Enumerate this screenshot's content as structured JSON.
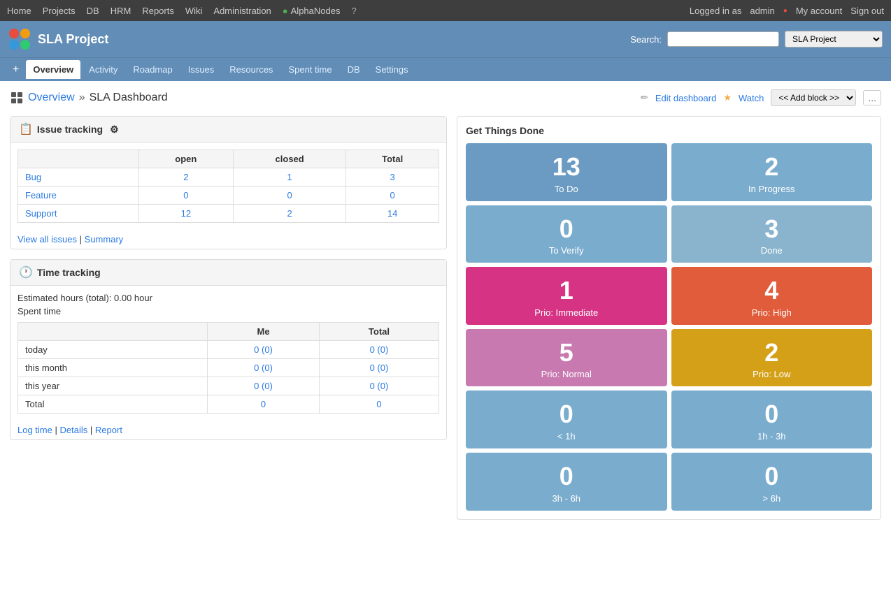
{
  "topnav": {
    "items": [
      "Home",
      "Projects",
      "DB",
      "HRM",
      "Reports",
      "Wiki",
      "Administration",
      "AlphaNodes"
    ],
    "logged_in_as": "Logged in as",
    "admin_label": "admin",
    "my_account": "My account",
    "sign_out": "Sign out"
  },
  "project": {
    "title": "SLA Project",
    "search_label": "Search:",
    "search_placeholder": "",
    "search_scope": "SLA Project"
  },
  "subnav": {
    "plus": "+",
    "items": [
      "Overview",
      "Activity",
      "Roadmap",
      "Issues",
      "Resources",
      "Spent time",
      "DB",
      "Settings"
    ]
  },
  "breadcrumb": {
    "overview": "Overview",
    "separator": "»",
    "page": "SLA Dashboard"
  },
  "page_actions": {
    "edit_dashboard": "Edit dashboard",
    "watch": "Watch",
    "add_block": "<< Add block >>",
    "more": "..."
  },
  "issue_tracking": {
    "title": "Issue tracking",
    "headers": [
      "",
      "open",
      "closed",
      "Total"
    ],
    "rows": [
      {
        "label": "Bug",
        "open": "2",
        "closed": "1",
        "total": "3"
      },
      {
        "label": "Feature",
        "open": "0",
        "closed": "0",
        "total": "0"
      },
      {
        "label": "Support",
        "open": "12",
        "closed": "2",
        "total": "14"
      }
    ],
    "view_all": "View all issues",
    "summary": "Summary"
  },
  "time_tracking": {
    "title": "Time tracking",
    "estimated_hours": "Estimated hours (total): 0.00 hour",
    "spent_time_label": "Spent time",
    "headers": [
      "",
      "Me",
      "Total"
    ],
    "rows": [
      {
        "label": "today",
        "me": "0 (0)",
        "total": "0 (0)"
      },
      {
        "label": "this month",
        "me": "0 (0)",
        "total": "0 (0)"
      },
      {
        "label": "this year",
        "me": "0 (0)",
        "total": "0 (0)"
      },
      {
        "label": "Total",
        "me": "0",
        "total": "0"
      }
    ],
    "log_time": "Log time",
    "details": "Details",
    "report": "Report"
  },
  "gtd": {
    "title": "Get Things Done",
    "cards": [
      {
        "number": "13",
        "label": "To Do",
        "class": "gtd-todo"
      },
      {
        "number": "2",
        "label": "In Progress",
        "class": "gtd-inprogress"
      },
      {
        "number": "0",
        "label": "To Verify",
        "class": "gtd-toverify"
      },
      {
        "number": "3",
        "label": "Done",
        "class": "gtd-done"
      },
      {
        "number": "1",
        "label": "Prio: Immediate",
        "class": "gtd-immediate"
      },
      {
        "number": "4",
        "label": "Prio: High",
        "class": "gtd-high"
      },
      {
        "number": "5",
        "label": "Prio: Normal",
        "class": "gtd-normal"
      },
      {
        "number": "2",
        "label": "Prio: Low",
        "class": "gtd-low"
      },
      {
        "number": "0",
        "label": "< 1h",
        "class": "gtd-less1h"
      },
      {
        "number": "0",
        "label": "1h - 3h",
        "class": "gtd-1h3h"
      },
      {
        "number": "0",
        "label": "3h - 6h",
        "class": "gtd-3h6h"
      },
      {
        "number": "0",
        "label": "> 6h",
        "class": "gtd-gt6h"
      }
    ]
  }
}
